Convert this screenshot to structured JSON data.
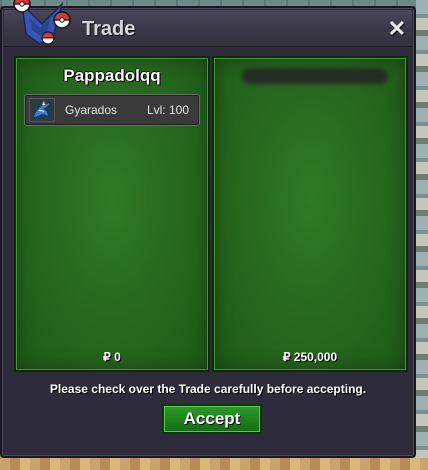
{
  "window": {
    "title": "Trade",
    "close_glyph": "✕"
  },
  "left_panel": {
    "player_name": "Pappadolqq",
    "offer": [
      {
        "pokemon": "Gyarados",
        "level": "Lvl: 100"
      }
    ],
    "money": "₽ 0"
  },
  "right_panel": {
    "player_name_blurred": true,
    "money": "₽ 250,000"
  },
  "footer": {
    "notice": "Please check over the Trade carefully before accepting.",
    "accept_label": "Accept"
  },
  "colors": {
    "panel_green": "#286a1f",
    "accept_green": "#1f7f1d",
    "window_bg": "#2e2c3a"
  },
  "icons": {
    "logo": "pokeball-logo-icon",
    "close": "close-icon",
    "pokemon": "gyarados-sprite-icon"
  }
}
